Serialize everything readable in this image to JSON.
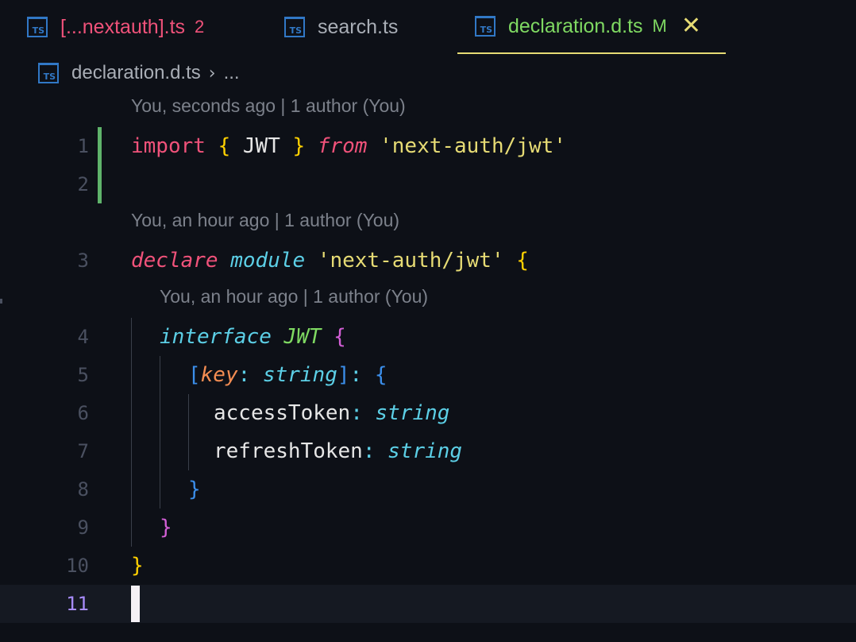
{
  "tabs": [
    {
      "label": "[...nextauth].ts",
      "badge": "2",
      "icon": "typescript-file-icon",
      "label_color": "#f0527a",
      "badge_color": "#f0527a"
    },
    {
      "label": "search.ts",
      "badge": "",
      "icon": "typescript-file-icon",
      "label_color": "#a9aeb6"
    },
    {
      "label": "declaration.d.ts",
      "badge": "M",
      "icon": "typescript-file-icon",
      "label_color": "#7fd962",
      "badge_color": "#7fd962",
      "active": true,
      "close_icon": "close-icon"
    }
  ],
  "ts_icon_text": "TS",
  "breadcrumb": {
    "file": "declaration.d.ts",
    "separator": "›",
    "more": "..."
  },
  "codelens": {
    "line1": "You, seconds ago | 1 author (You)",
    "line3": "You, an hour ago | 1 author (You)",
    "line4": "You, an hour ago | 1 author (You)"
  },
  "line_numbers": [
    "1",
    "2",
    "3",
    "4",
    "5",
    "6",
    "7",
    "8",
    "9",
    "10",
    "11"
  ],
  "code": {
    "l1": {
      "import": "import",
      "open": "{",
      "name": "JWT",
      "close": "}",
      "from": "from",
      "module": "'next-auth/jwt'"
    },
    "l3": {
      "declare": "declare",
      "module": "module",
      "name": "'next-auth/jwt'",
      "open": "{"
    },
    "l4": {
      "interface": "interface",
      "name": "JWT",
      "open": "{"
    },
    "l5": {
      "lbracket": "[",
      "key": "key",
      "colon": ":",
      "type": "string",
      "rbracket": "]",
      "colon2": ":",
      "open": "{"
    },
    "l6": {
      "prop": "accessToken",
      "colon": ":",
      "type": "string"
    },
    "l7": {
      "prop": "refreshToken",
      "colon": ":",
      "type": "string"
    },
    "l8": {
      "close": "}"
    },
    "l9": {
      "close": "}"
    },
    "l10": {
      "close": "}"
    }
  },
  "colors": {
    "background": "#0d1017",
    "git_modified_bar": "#5fb36b",
    "active_tab_underline": "#e6db74"
  }
}
